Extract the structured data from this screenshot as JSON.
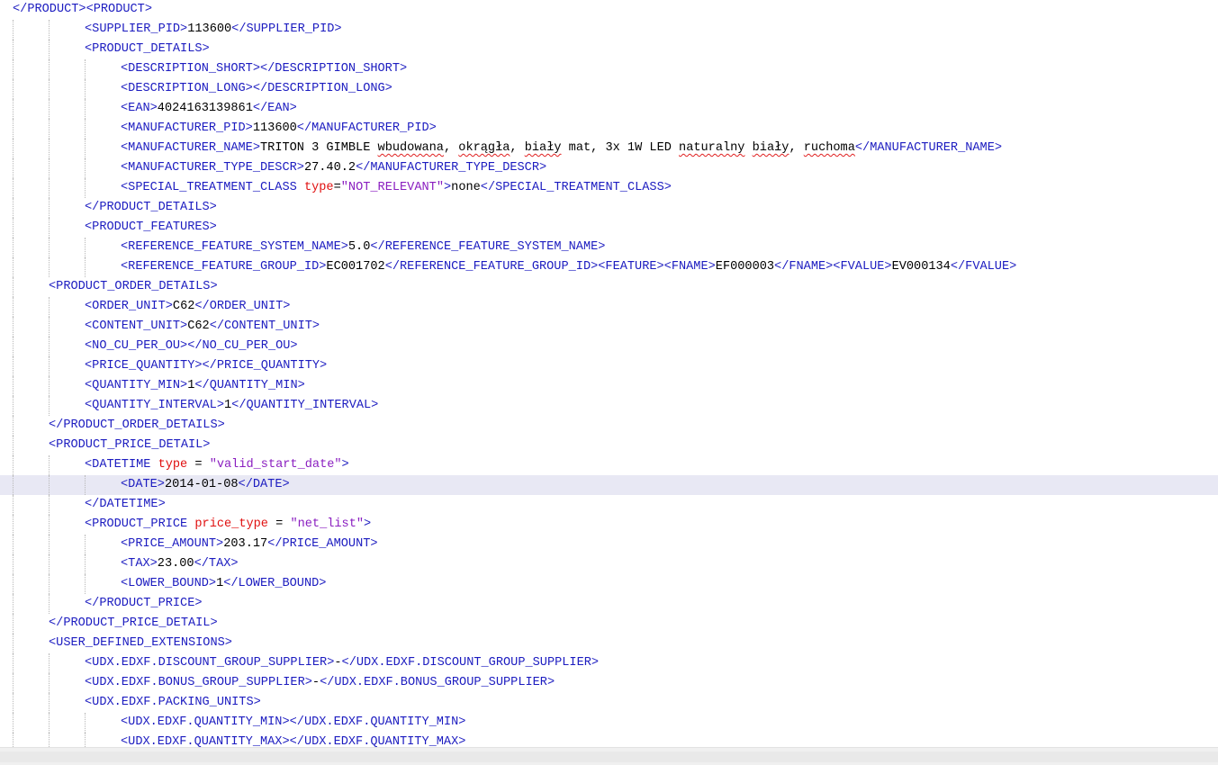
{
  "editor": {
    "lines": [
      {
        "indent": 0,
        "tokens": [
          {
            "t": "tag",
            "v": "</PRODUCT><PRODUCT>"
          }
        ]
      },
      {
        "indent": 2,
        "tokens": [
          {
            "t": "tag",
            "v": "<SUPPLIER_PID>"
          },
          {
            "t": "txt",
            "v": "113600"
          },
          {
            "t": "tag",
            "v": "</SUPPLIER_PID>"
          }
        ]
      },
      {
        "indent": 2,
        "tokens": [
          {
            "t": "tag",
            "v": "<PRODUCT_DETAILS>"
          }
        ]
      },
      {
        "indent": 3,
        "tokens": [
          {
            "t": "tag",
            "v": "<DESCRIPTION_SHORT></DESCRIPTION_SHORT>"
          }
        ]
      },
      {
        "indent": 3,
        "tokens": [
          {
            "t": "tag",
            "v": "<DESCRIPTION_LONG></DESCRIPTION_LONG>"
          }
        ]
      },
      {
        "indent": 3,
        "tokens": [
          {
            "t": "tag",
            "v": "<EAN>"
          },
          {
            "t": "txt",
            "v": "4024163139861"
          },
          {
            "t": "tag",
            "v": "</EAN>"
          }
        ]
      },
      {
        "indent": 3,
        "tokens": [
          {
            "t": "tag",
            "v": "<MANUFACTURER_PID>"
          },
          {
            "t": "txt",
            "v": "113600"
          },
          {
            "t": "tag",
            "v": "</MANUFACTURER_PID>"
          }
        ]
      },
      {
        "indent": 3,
        "tokens": [
          {
            "t": "tag",
            "v": "<MANUFACTURER_NAME>"
          },
          {
            "t": "txt",
            "v": "TRITON 3 GIMBLE "
          },
          {
            "t": "sq",
            "v": "wbudowana"
          },
          {
            "t": "txt",
            "v": ", "
          },
          {
            "t": "sq",
            "v": "okrągła"
          },
          {
            "t": "txt",
            "v": ", "
          },
          {
            "t": "sq",
            "v": "biały"
          },
          {
            "t": "txt",
            "v": " mat, 3x 1W LED "
          },
          {
            "t": "sq",
            "v": "naturalny"
          },
          {
            "t": "txt",
            "v": " "
          },
          {
            "t": "sq",
            "v": "biały"
          },
          {
            "t": "txt",
            "v": ", "
          },
          {
            "t": "sq",
            "v": "ruchoma"
          },
          {
            "t": "tag",
            "v": "</MANUFACTURER_NAME>"
          }
        ]
      },
      {
        "indent": 3,
        "tokens": [
          {
            "t": "tag",
            "v": "<MANUFACTURER_TYPE_DESCR>"
          },
          {
            "t": "txt",
            "v": "27.40.2"
          },
          {
            "t": "tag",
            "v": "</MANUFACTURER_TYPE_DESCR>"
          }
        ]
      },
      {
        "indent": 3,
        "tokens": [
          {
            "t": "tag",
            "v": "<SPECIAL_TREATMENT_CLASS "
          },
          {
            "t": "attr",
            "v": "type"
          },
          {
            "t": "txt",
            "v": "="
          },
          {
            "t": "val",
            "v": "\"NOT_RELEVANT\""
          },
          {
            "t": "tag",
            "v": ">"
          },
          {
            "t": "txt",
            "v": "none"
          },
          {
            "t": "tag",
            "v": "</SPECIAL_TREATMENT_CLASS>"
          }
        ]
      },
      {
        "indent": 2,
        "tokens": [
          {
            "t": "tag",
            "v": "</PRODUCT_DETAILS>"
          }
        ]
      },
      {
        "indent": 2,
        "tokens": [
          {
            "t": "tag",
            "v": "<PRODUCT_FEATURES>"
          }
        ]
      },
      {
        "indent": 3,
        "tokens": [
          {
            "t": "tag",
            "v": "<REFERENCE_FEATURE_SYSTEM_NAME>"
          },
          {
            "t": "txt",
            "v": "5.0"
          },
          {
            "t": "tag",
            "v": "</REFERENCE_FEATURE_SYSTEM_NAME>"
          }
        ]
      },
      {
        "indent": 3,
        "tokens": [
          {
            "t": "tag",
            "v": "<REFERENCE_FEATURE_GROUP_ID>"
          },
          {
            "t": "txt",
            "v": "EC001702"
          },
          {
            "t": "tag",
            "v": "</REFERENCE_FEATURE_GROUP_ID><FEATURE><FNAME>"
          },
          {
            "t": "txt",
            "v": "EF000003"
          },
          {
            "t": "tag",
            "v": "</FNAME><FVALUE>"
          },
          {
            "t": "txt",
            "v": "EV000134"
          },
          {
            "t": "tag",
            "v": "</FVALUE>"
          }
        ]
      },
      {
        "indent": 1,
        "tokens": [
          {
            "t": "tag",
            "v": "<PRODUCT_ORDER_DETAILS>"
          }
        ]
      },
      {
        "indent": 2,
        "tokens": [
          {
            "t": "tag",
            "v": "<ORDER_UNIT>"
          },
          {
            "t": "txt",
            "v": "C62"
          },
          {
            "t": "tag",
            "v": "</ORDER_UNIT>"
          }
        ]
      },
      {
        "indent": 2,
        "tokens": [
          {
            "t": "tag",
            "v": "<CONTENT_UNIT>"
          },
          {
            "t": "txt",
            "v": "C62"
          },
          {
            "t": "tag",
            "v": "</CONTENT_UNIT>"
          }
        ]
      },
      {
        "indent": 2,
        "tokens": [
          {
            "t": "tag",
            "v": "<NO_CU_PER_OU></NO_CU_PER_OU>"
          }
        ]
      },
      {
        "indent": 2,
        "tokens": [
          {
            "t": "tag",
            "v": "<PRICE_QUANTITY></PRICE_QUANTITY>"
          }
        ]
      },
      {
        "indent": 2,
        "tokens": [
          {
            "t": "tag",
            "v": "<QUANTITY_MIN>"
          },
          {
            "t": "txt",
            "v": "1"
          },
          {
            "t": "tag",
            "v": "</QUANTITY_MIN>"
          }
        ]
      },
      {
        "indent": 2,
        "tokens": [
          {
            "t": "tag",
            "v": "<QUANTITY_INTERVAL>"
          },
          {
            "t": "txt",
            "v": "1"
          },
          {
            "t": "tag",
            "v": "</QUANTITY_INTERVAL>"
          }
        ]
      },
      {
        "indent": 1,
        "tokens": [
          {
            "t": "tag",
            "v": "</PRODUCT_ORDER_DETAILS>"
          }
        ]
      },
      {
        "indent": 1,
        "tokens": [
          {
            "t": "tag",
            "v": "<PRODUCT_PRICE_DETAIL>"
          }
        ]
      },
      {
        "indent": 2,
        "tokens": [
          {
            "t": "tag",
            "v": "<DATETIME "
          },
          {
            "t": "attr",
            "v": "type"
          },
          {
            "t": "txt",
            "v": " = "
          },
          {
            "t": "val",
            "v": "\"valid_start_date\""
          },
          {
            "t": "tag",
            "v": ">"
          }
        ]
      },
      {
        "indent": 3,
        "current": true,
        "tokens": [
          {
            "t": "tag",
            "v": "<DATE>"
          },
          {
            "t": "txt",
            "v": "2014-01-08"
          },
          {
            "t": "tag",
            "v": "</DATE>"
          }
        ]
      },
      {
        "indent": 2,
        "tokens": [
          {
            "t": "tag",
            "v": "</DATETIME>"
          }
        ]
      },
      {
        "indent": 2,
        "tokens": [
          {
            "t": "tag",
            "v": "<PRODUCT_PRICE "
          },
          {
            "t": "attr",
            "v": "price_type"
          },
          {
            "t": "txt",
            "v": " = "
          },
          {
            "t": "val",
            "v": "\"net_list\""
          },
          {
            "t": "tag",
            "v": ">"
          }
        ]
      },
      {
        "indent": 3,
        "tokens": [
          {
            "t": "tag",
            "v": "<PRICE_AMOUNT>"
          },
          {
            "t": "txt",
            "v": "203.17"
          },
          {
            "t": "tag",
            "v": "</PRICE_AMOUNT>"
          }
        ]
      },
      {
        "indent": 3,
        "tokens": [
          {
            "t": "tag",
            "v": "<TAX>"
          },
          {
            "t": "txt",
            "v": "23.00"
          },
          {
            "t": "tag",
            "v": "</TAX>"
          }
        ]
      },
      {
        "indent": 3,
        "tokens": [
          {
            "t": "tag",
            "v": "<LOWER_BOUND>"
          },
          {
            "t": "txt",
            "v": "1"
          },
          {
            "t": "tag",
            "v": "</LOWER_BOUND>"
          }
        ]
      },
      {
        "indent": 2,
        "tokens": [
          {
            "t": "tag",
            "v": "</PRODUCT_PRICE>"
          }
        ]
      },
      {
        "indent": 1,
        "tokens": [
          {
            "t": "tag",
            "v": "</PRODUCT_PRICE_DETAIL>"
          }
        ]
      },
      {
        "indent": 1,
        "tokens": [
          {
            "t": "tag",
            "v": "<USER_DEFINED_EXTENSIONS>"
          }
        ]
      },
      {
        "indent": 2,
        "tokens": [
          {
            "t": "tag",
            "v": "<UDX.EDXF.DISCOUNT_GROUP_SUPPLIER>"
          },
          {
            "t": "txt",
            "v": "-"
          },
          {
            "t": "tag",
            "v": "</UDX.EDXF.DISCOUNT_GROUP_SUPPLIER>"
          }
        ]
      },
      {
        "indent": 2,
        "tokens": [
          {
            "t": "tag",
            "v": "<UDX.EDXF.BONUS_GROUP_SUPPLIER>"
          },
          {
            "t": "txt",
            "v": "-"
          },
          {
            "t": "tag",
            "v": "</UDX.EDXF.BONUS_GROUP_SUPPLIER>"
          }
        ]
      },
      {
        "indent": 2,
        "tokens": [
          {
            "t": "tag",
            "v": "<UDX.EDXF.PACKING_UNITS>"
          }
        ]
      },
      {
        "indent": 3,
        "tokens": [
          {
            "t": "tag",
            "v": "<UDX.EDXF.QUANTITY_MIN></UDX.EDXF.QUANTITY_MIN>"
          }
        ]
      },
      {
        "indent": 3,
        "tokens": [
          {
            "t": "tag",
            "v": "<UDX.EDXF.QUANTITY_MAX></UDX.EDXF.QUANTITY_MAX>"
          }
        ]
      }
    ]
  },
  "colors": {
    "tag": "#1c1cc0",
    "attribute": "#e01010",
    "attribute_value": "#8a1ec0",
    "text": "#000000",
    "current_line": "#e8e8f4",
    "spellcheck": "#e02020"
  }
}
